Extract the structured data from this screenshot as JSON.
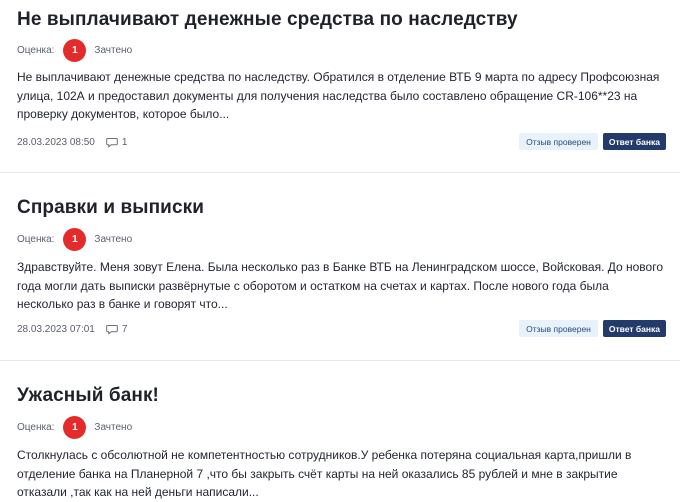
{
  "reviews": [
    {
      "title": "Не выплачивают денежные средства по наследству",
      "rating_label": "Оценка:",
      "rating": "1",
      "status": "Зачтено",
      "text": "Не выплачивают денежные средства по наследству. Обратился в отделение ВТБ 9 марта по адресу Профсоюзная улица, 102А и предоставил документы для получения наследства было составлено обращение CR-106**23 на проверку документов, которое было...",
      "date": "28.03.2023 08:50",
      "comments": "1",
      "tag_checked": "Отзыв проверен",
      "tag_answer": "Ответ банка"
    },
    {
      "title": "Справки и выписки",
      "rating_label": "Оценка:",
      "rating": "1",
      "status": "Зачтено",
      "text": "Здравствуйте. Меня зовут Елена. Была несколько раз в Банке ВТБ на Ленинградском шоссе, Войсковая. До нового года могли дать выписки развёрнутые с оборотом и остатком на счетах и картах. После нового года была несколько раз в банке и говорят что...",
      "date": "28.03.2023 07:01",
      "comments": "7",
      "tag_checked": "Отзыв проверен",
      "tag_answer": "Ответ банка"
    },
    {
      "title": "Ужасный банк!",
      "rating_label": "Оценка:",
      "rating": "1",
      "status": "Зачтено",
      "text": "Столкнулась с обсолютной не компетентностью сотрудников.У ребенка потеряна социальная карта,пришли в отделение банка на Планерной 7 ,что бы закрыть счёт карты на ней оказались 85 рублей и мне в закрытие отказали ,так как на ней деньги написали..."
    }
  ]
}
